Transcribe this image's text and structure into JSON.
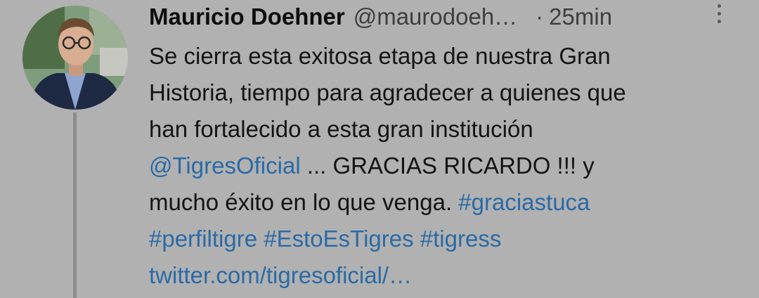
{
  "tweet": {
    "author_name": "Mauricio Doehner",
    "handle": "@maurodoeh…",
    "separator": "·",
    "time": "25min",
    "more_icon": "more-vertical-icon",
    "avatar": "author-avatar",
    "text": {
      "line1": "Se cierra esta exitosa etapa de nuestra Gran",
      "line2": "Historia, tiempo para agradecer a quienes que",
      "line3": "han fortalecido a esta gran institución",
      "mention": "@TigresOficial",
      "line4_rest": " ... GRACIAS RICARDO !!! y",
      "line5_plain": "mucho éxito en lo que venga. ",
      "hashtag1": "#graciastuca",
      "hashtag2": "#perfiltigre",
      "hashtag3": "#EstoEsTigres",
      "hashtag4": "#tigress",
      "url": "twitter.com/tigresoficial/…"
    },
    "colors": {
      "background": "#b1b1b1",
      "link": "#2a6aa6",
      "text": "#141414",
      "secondary": "#3e3e3e"
    }
  }
}
